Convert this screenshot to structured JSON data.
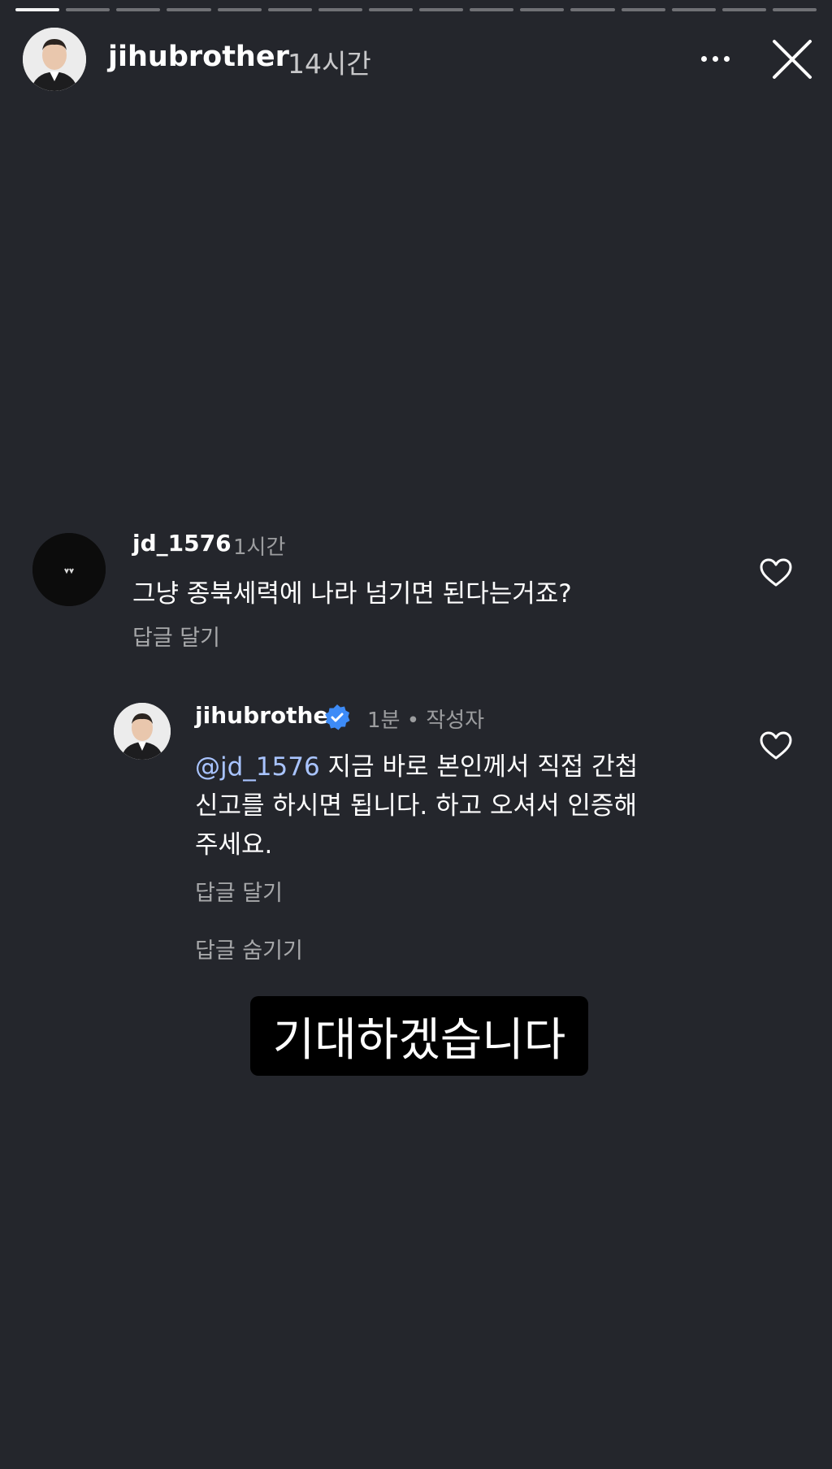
{
  "header": {
    "username": "jihubrother",
    "time": "14시간",
    "more_icon": "more-horizontal-icon",
    "close_icon": "close-icon",
    "progress_total": 16,
    "progress_current": 1
  },
  "comment": {
    "username": "jd_1576",
    "time": "1시간",
    "text": "그냥 종북세력에 나라 넘기면 된다는거죠?",
    "reply_label": "답글 달기",
    "like_icon": "heart-icon"
  },
  "reply": {
    "username": "jihubrother",
    "verified_icon": "verified-badge-icon",
    "meta": "1분 • 작성자",
    "mention": "@jd_1576",
    "text": "지금 바로 본인께서 직접 간첩신고를 하시면 됩니다. 하고 오셔서 인증해주세요.",
    "reply_label": "답글 달기",
    "hide_label": "답글 숨기기",
    "like_icon": "heart-icon"
  },
  "caption": {
    "text": "기대하겠습니다"
  },
  "colors": {
    "background": "#24262c",
    "mention": "#a9c4ff",
    "verified": "#3d8bf7"
  }
}
